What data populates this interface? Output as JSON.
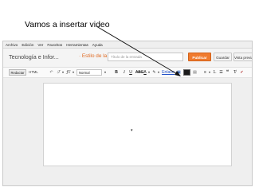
{
  "caption": "Vamos a insertar video",
  "menu": [
    "Archivo",
    "Edición",
    "Ver",
    "Favoritos",
    "Herramientas",
    "Ayuda"
  ],
  "header": {
    "blog_title": "Tecnología e Infor...",
    "post_crumb": "· Estilo de la entrada",
    "title_placeholder": "Título de la entrada",
    "publish_label": "Publicar",
    "save_label": "Guardar",
    "preview_label": "Vista previa"
  },
  "toolbar": {
    "compose_label": "Redactar",
    "html_label": "HTML",
    "font_size_value": "Normal",
    "link_label": "Enlace"
  },
  "colors": {
    "publish": "#f07b2e",
    "link": "#1d4ec7",
    "crumb": "#e06a22"
  }
}
